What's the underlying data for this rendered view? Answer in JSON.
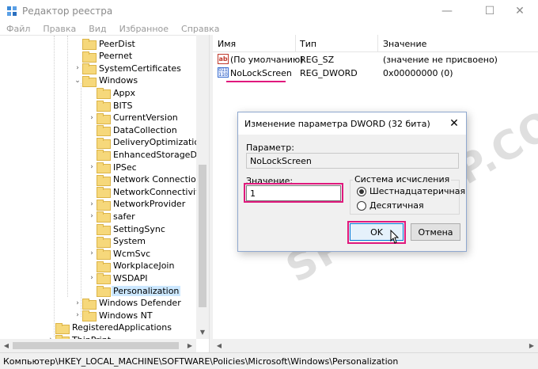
{
  "window": {
    "title": "Редактор реестра",
    "controls": {
      "minimize_icon": "minimize-icon",
      "maximize_icon": "maximize-icon",
      "close_icon": "close-icon"
    }
  },
  "menu": [
    "Файл",
    "Правка",
    "Вид",
    "Избранное",
    "Справка"
  ],
  "tree": {
    "items": [
      {
        "label": "PeerDist",
        "expander": ""
      },
      {
        "label": "Peernet",
        "expander": ""
      },
      {
        "label": "SystemCertificates",
        "expander": "›"
      },
      {
        "label": "Windows",
        "expander": "⌄"
      },
      {
        "label": "Appx",
        "expander": ""
      },
      {
        "label": "BITS",
        "expander": ""
      },
      {
        "label": "CurrentVersion",
        "expander": "›"
      },
      {
        "label": "DataCollection",
        "expander": ""
      },
      {
        "label": "DeliveryOptimization",
        "expander": ""
      },
      {
        "label": "EnhancedStorageDevice",
        "expander": ""
      },
      {
        "label": "IPSec",
        "expander": "›"
      },
      {
        "label": "Network Connections",
        "expander": ""
      },
      {
        "label": "NetworkConnectivitySta",
        "expander": ""
      },
      {
        "label": "NetworkProvider",
        "expander": "›"
      },
      {
        "label": "safer",
        "expander": "›"
      },
      {
        "label": "SettingSync",
        "expander": ""
      },
      {
        "label": "System",
        "expander": ""
      },
      {
        "label": "WcmSvc",
        "expander": "›"
      },
      {
        "label": "WorkplaceJoin",
        "expander": ""
      },
      {
        "label": "WSDAPI",
        "expander": "›"
      },
      {
        "label": "Personalization",
        "expander": "",
        "selected": true
      },
      {
        "label": "Windows Defender",
        "expander": "›"
      },
      {
        "label": "Windows NT",
        "expander": "›"
      },
      {
        "label": "RegisteredApplications",
        "expander": ""
      },
      {
        "label": "ThinPrint",
        "expander": "›"
      }
    ]
  },
  "list": {
    "columns": [
      "Имя",
      "Тип",
      "Значение"
    ],
    "rows": [
      {
        "icon": "ab",
        "name": "(По умолчанию)",
        "type": "REG_SZ",
        "value": "(значение не присвоено)"
      },
      {
        "icon": "bin",
        "name": "NoLockScreen",
        "type": "REG_DWORD",
        "value": "0x00000000 (0)"
      }
    ]
  },
  "status": "Компьютер\\HKEY_LOCAL_MACHINE\\SOFTWARE\\Policies\\Microsoft\\Windows\\Personalization",
  "dialog": {
    "title": "Изменение параметра DWORD (32 бита)",
    "param_label": "Параметр:",
    "param_value": "NoLockScreen",
    "value_label": "Значение:",
    "value": "1",
    "base_group_label": "Система исчисления",
    "base_hex": "Шестнадцатеричная",
    "base_dec": "Десятичная",
    "selected_base": "hex",
    "ok": "OK",
    "cancel": "Отмена"
  },
  "watermark": "SPYCOMP.COM",
  "colors": {
    "highlight": "#e0197d",
    "selection": "#cce8ff",
    "folder": "#f6d87b"
  }
}
